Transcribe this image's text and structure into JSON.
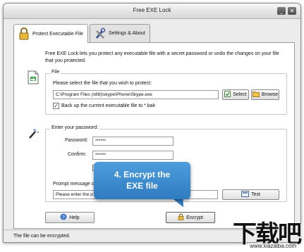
{
  "window": {
    "title": "Free EXE Lock",
    "minimize_glyph": "_",
    "close_glyph": "✕"
  },
  "tabs": [
    {
      "label": "Protect Executable File",
      "icon": "lock-icon"
    },
    {
      "label": "Settings & About",
      "icon": "tools-icon"
    }
  ],
  "intro_text": "Free EXE Lock lets you protect any executable file with a secret password or undo the changes on your file that you protected.",
  "file_group": {
    "legend": "File",
    "prompt": "Please select the file that you wish to protect:",
    "path_value": "C:\\Program Files (x86)\\skype\\Phone\\Skype.exe",
    "select_label": "Select",
    "browse_label": "Browse",
    "backup_label": "Back up the current executable file to *.bak",
    "backup_checked": true
  },
  "password_group": {
    "legend": "Enter your password:",
    "password_label": "Password:",
    "password_value": "******",
    "confirm_label": "Confirm:",
    "confirm_value": "******",
    "prompt_label": "Prompt message o",
    "prompt_value": "Please enter the p",
    "test_label": "Test"
  },
  "buttons": {
    "help_label": "Help",
    "encrypt_label": "Encrypt"
  },
  "status_text": "The file can be encrypted.",
  "callout": {
    "line1": "4. Encrypt the",
    "line2": "EXE file"
  },
  "watermark": {
    "main": "下载吧",
    "sub": "www.xiazaiba.com"
  },
  "colors": {
    "callout": "#3a8bd1",
    "window_bg": "#ececec"
  }
}
